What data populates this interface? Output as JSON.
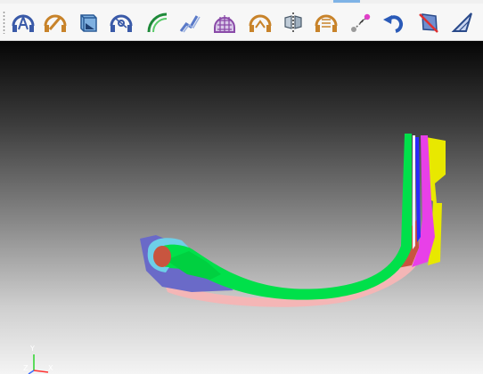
{
  "window": {
    "accent_color": "#7fb3e6"
  },
  "toolbar": {
    "buttons": [
      {
        "icon": "auto-mesh-icon",
        "tooltip": ""
      },
      {
        "icon": "edit-geometry-icon",
        "tooltip": ""
      },
      {
        "icon": "surface-box-icon",
        "tooltip": ""
      },
      {
        "icon": "tire-section-icon",
        "tooltip": ""
      },
      {
        "icon": "arc-curve-icon",
        "tooltip": ""
      },
      {
        "icon": "spline-curve-icon",
        "tooltip": ""
      },
      {
        "icon": "grid-mesh-icon",
        "tooltip": ""
      },
      {
        "icon": "profile-mesh-icon",
        "tooltip": ""
      },
      {
        "icon": "mirror-symmetry-icon",
        "tooltip": ""
      },
      {
        "icon": "layer-stack-icon",
        "tooltip": ""
      },
      {
        "icon": "node-connect-icon",
        "tooltip": ""
      },
      {
        "icon": "undo-rotate-icon",
        "tooltip": ""
      },
      {
        "icon": "box-select-icon",
        "tooltip": ""
      },
      {
        "icon": "measure-angle-icon",
        "tooltip": ""
      }
    ]
  },
  "viewport": {
    "background_top": "#050505",
    "background_bottom": "#f4f4f4",
    "axes": {
      "y_label": "Y",
      "z_label": "Z",
      "x_label": "X"
    },
    "model_colors": {
      "outer_liner": "#f4b6b6",
      "bead_filler": "#6a6ac8",
      "carcass": "#00e04a",
      "sidewall": "#e8e800",
      "belt": "#e840e8",
      "apex": "#c8553f",
      "inner_band": "#2a2aff",
      "cap": "#6ecfe8"
    }
  }
}
